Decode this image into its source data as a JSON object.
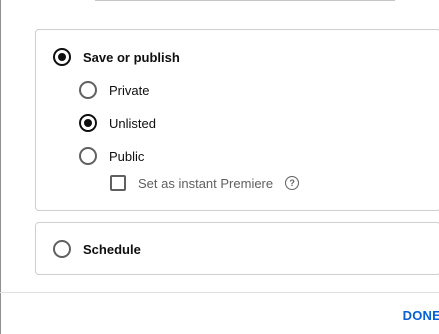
{
  "visibility": {
    "publish_section": {
      "label": "Save or publish",
      "options": [
        {
          "label": "Private"
        },
        {
          "label": "Unlisted"
        },
        {
          "label": "Public"
        }
      ],
      "premiere_label": "Set as instant Premiere",
      "help_glyph": "?"
    },
    "schedule_label": "Schedule"
  },
  "footer": {
    "done_label": "DONE"
  },
  "colors": {
    "accent": "#065fd4",
    "text": "#0f0f0f",
    "muted": "#606060",
    "border": "#cfcfcf"
  }
}
